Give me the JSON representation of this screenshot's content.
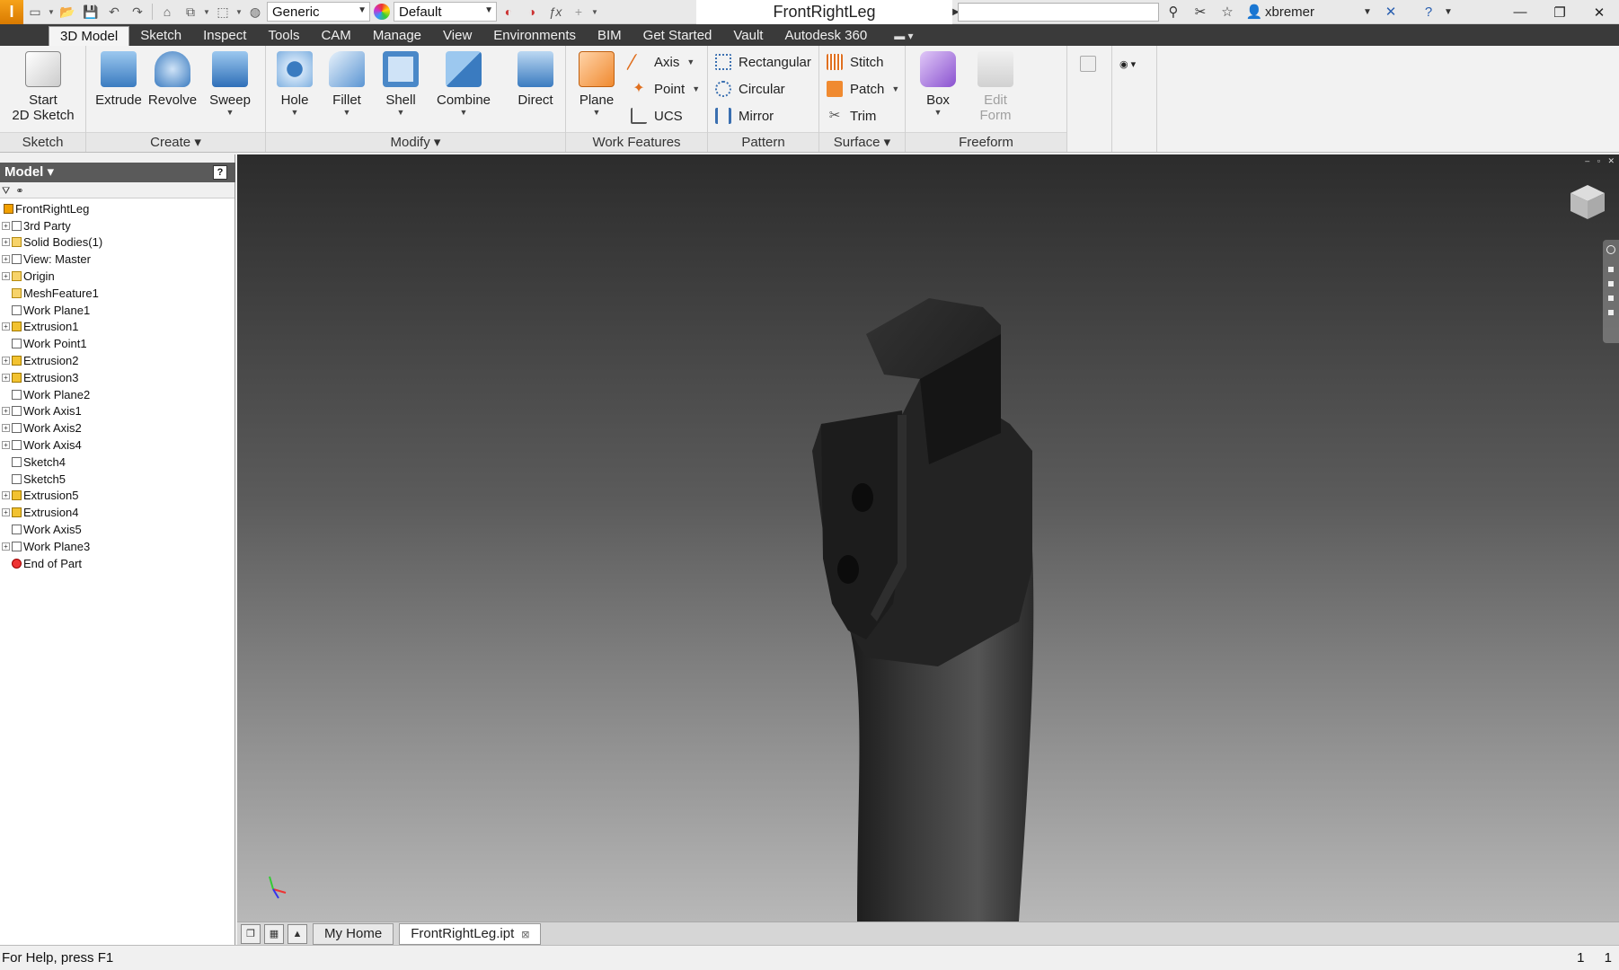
{
  "titlebar": {
    "appearance_style": "Generic",
    "material": "Default",
    "document_title": "FrontRightLeg",
    "search_placeholder": "",
    "user": "xbremer"
  },
  "ribbon_tabs": [
    "3D Model",
    "Sketch",
    "Inspect",
    "Tools",
    "CAM",
    "Manage",
    "View",
    "Environments",
    "BIM",
    "Get Started",
    "Vault",
    "Autodesk 360"
  ],
  "active_tab": "3D Model",
  "ribbon": {
    "sketch": {
      "title": "Sketch",
      "start_line1": "Start",
      "start_line2": "2D Sketch"
    },
    "create": {
      "title": "Create",
      "extrude": "Extrude",
      "revolve": "Revolve",
      "sweep": "Sweep"
    },
    "modify": {
      "title": "Modify",
      "hole": "Hole",
      "fillet": "Fillet",
      "shell": "Shell",
      "combine": "Combine",
      "direct": "Direct"
    },
    "work_features": {
      "title": "Work Features",
      "plane": "Plane",
      "axis": "Axis",
      "point": "Point",
      "ucs": "UCS"
    },
    "pattern": {
      "title": "Pattern",
      "rectangular": "Rectangular",
      "circular": "Circular",
      "mirror": "Mirror"
    },
    "surface": {
      "title": "Surface",
      "stitch": "Stitch",
      "patch": "Patch",
      "trim": "Trim"
    },
    "freeform": {
      "title": "Freeform",
      "box": "Box",
      "edit_line1": "Edit",
      "edit_line2": "Form"
    }
  },
  "browser": {
    "title": "Model",
    "help": "?",
    "items": [
      {
        "label": "FrontRightLeg",
        "level": 0,
        "expandable": false,
        "icon": "part"
      },
      {
        "label": "3rd Party",
        "level": 1,
        "expandable": true,
        "icon": "plane"
      },
      {
        "label": "Solid Bodies(1)",
        "level": 1,
        "expandable": true,
        "icon": "folder"
      },
      {
        "label": "View: Master",
        "level": 1,
        "expandable": true,
        "icon": "plane"
      },
      {
        "label": "Origin",
        "level": 1,
        "expandable": true,
        "icon": "folder"
      },
      {
        "label": "MeshFeature1",
        "level": 1,
        "expandable": false,
        "icon": "folder"
      },
      {
        "label": "Work Plane1",
        "level": 1,
        "expandable": false,
        "icon": "plane"
      },
      {
        "label": "Extrusion1",
        "level": 1,
        "expandable": true,
        "icon": "feat"
      },
      {
        "label": "Work Point1",
        "level": 1,
        "expandable": false,
        "icon": "plane"
      },
      {
        "label": "Extrusion2",
        "level": 1,
        "expandable": true,
        "icon": "feat"
      },
      {
        "label": "Extrusion3",
        "level": 1,
        "expandable": true,
        "icon": "feat"
      },
      {
        "label": "Work Plane2",
        "level": 1,
        "expandable": false,
        "icon": "plane"
      },
      {
        "label": "Work Axis1",
        "level": 1,
        "expandable": true,
        "icon": "plane"
      },
      {
        "label": "Work Axis2",
        "level": 1,
        "expandable": true,
        "icon": "plane"
      },
      {
        "label": "Work Axis4",
        "level": 1,
        "expandable": true,
        "icon": "plane"
      },
      {
        "label": "Sketch4",
        "level": 1,
        "expandable": false,
        "icon": "plane"
      },
      {
        "label": "Sketch5",
        "level": 1,
        "expandable": false,
        "icon": "plane"
      },
      {
        "label": "Extrusion5",
        "level": 1,
        "expandable": true,
        "icon": "feat"
      },
      {
        "label": "Extrusion4",
        "level": 1,
        "expandable": true,
        "icon": "feat"
      },
      {
        "label": "Work Axis5",
        "level": 1,
        "expandable": false,
        "icon": "plane"
      },
      {
        "label": "Work Plane3",
        "level": 1,
        "expandable": true,
        "icon": "plane"
      },
      {
        "label": "End of Part",
        "level": 1,
        "expandable": false,
        "icon": "end"
      }
    ]
  },
  "doc_tabs": {
    "home": "My Home",
    "active": "FrontRightLeg.ipt"
  },
  "status": {
    "help_text": "For Help, press F1",
    "count1": "1",
    "count2": "1"
  },
  "colors": {
    "ribbon_tab_bar": "#3a3a3a",
    "accent_orange": "#f6a21a",
    "model_mesh": "#2a2a2a"
  }
}
